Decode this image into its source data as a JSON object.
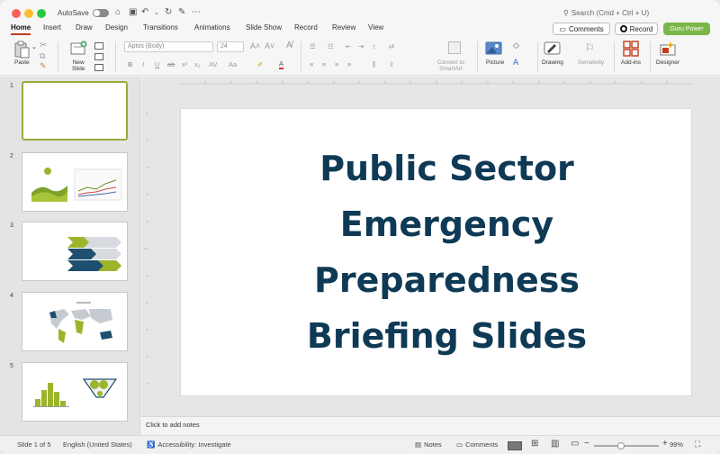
{
  "titlebar": {
    "autosave_label": "AutoSave",
    "search_placeholder": "Search (Cmd + Ctrl + U)"
  },
  "tabs": [
    {
      "label": "Home"
    },
    {
      "label": "Insert"
    },
    {
      "label": "Draw"
    },
    {
      "label": "Design"
    },
    {
      "label": "Transitions"
    },
    {
      "label": "Animations"
    },
    {
      "label": "Slide Show"
    },
    {
      "label": "Record"
    },
    {
      "label": "Review"
    },
    {
      "label": "View"
    }
  ],
  "header_buttons": {
    "comments": "Comments",
    "record": "Record",
    "guru": "Guru Power"
  },
  "ribbon": {
    "paste": "Paste",
    "new_slide_1": "New",
    "new_slide_2": "Slide",
    "font_name": "Aptos (Body)",
    "font_size": "24",
    "convert_1": "Convert to",
    "convert_2": "SmartArt",
    "picture": "Picture",
    "drawing": "Drawing",
    "sensitivity": "Sensitivity",
    "addins": "Add-ins",
    "designer": "Designer"
  },
  "thumbnails": [
    {
      "number": "1"
    },
    {
      "number": "2"
    },
    {
      "number": "3"
    },
    {
      "number": "4"
    },
    {
      "number": "5"
    }
  ],
  "slide": {
    "title_line1": "Public Sector",
    "title_line2": "Emergency",
    "title_line3": "Preparedness",
    "title_line4": "Briefing Slides"
  },
  "notes_placeholder": "Click to add notes",
  "status": {
    "slide_count": "Slide 1 of 5",
    "language": "English (United States)",
    "accessibility": "Accessibility: Investigate",
    "notes": "Notes",
    "comments": "Comments",
    "zoom": "99%"
  },
  "colors": {
    "title_text": "#0f3a55",
    "accent_green": "#7ab648",
    "active_tab_underline": "#c43e1c",
    "selected_thumb_border": "#9aab3c"
  }
}
